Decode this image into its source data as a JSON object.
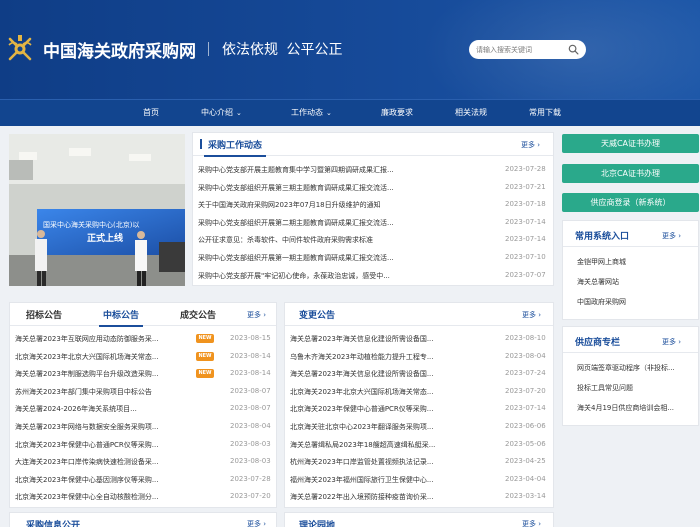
{
  "header": {
    "title": "中国海关政府采购网",
    "slogan": "依法依规  公平公正",
    "search_placeholder": "请输入搜索关键词"
  },
  "nav": [
    {
      "label": "首页",
      "has_menu": false
    },
    {
      "label": "中心介绍",
      "has_menu": true
    },
    {
      "label": "工作动态",
      "has_menu": true
    },
    {
      "label": "廉政要求",
      "has_menu": false
    },
    {
      "label": "相关法规",
      "has_menu": false
    },
    {
      "label": "常用下载",
      "has_menu": false
    }
  ],
  "more_label": "更多",
  "photo": {
    "banner_line1": "国采中心海关采购中心(北京)以",
    "banner_line2": "正式上线"
  },
  "work_news": {
    "title": "采购工作动态",
    "items": [
      {
        "title": "采购中心党支部开展主题教育集中学习暨第四期调研成果汇报...",
        "date": "2023-07-28"
      },
      {
        "title": "采购中心党支部组织开展第三期主题教育调研成果汇报交流活...",
        "date": "2023-07-21"
      },
      {
        "title": "关于中国海关政府采购网2023年07月18日升级维护的通知",
        "date": "2023-07-18"
      },
      {
        "title": "采购中心党支部组织开展第二期主题教育调研成果汇报交流活...",
        "date": "2023-07-14"
      },
      {
        "title": "公开征求意见：杀毒软件、中间件软件政府采购需求标准",
        "date": "2023-07-14"
      },
      {
        "title": "采购中心党支部组织开展第一期主题教育调研成果汇报交流活...",
        "date": "2023-07-10"
      },
      {
        "title": "采购中心党支部开展\"牢记初心使命，永葆政治忠诚，感受中...",
        "date": "2023-07-07"
      }
    ]
  },
  "side_buttons": [
    "天威CA证书办理",
    "北京CA证书办理",
    "供应商登录（新系统）"
  ],
  "common_systems": {
    "title": "常用系统入口",
    "items": [
      "金铠甲网上商城",
      "海关总署网站",
      "中国政府采购网"
    ]
  },
  "supplier": {
    "title": "供应商专栏",
    "items": [
      "网页端签章驱动程序（非投标...",
      "投标工具常见问题",
      "海关4月19日供应商培训会相..."
    ]
  },
  "bids": {
    "tabs": [
      "招标公告",
      "中标公告",
      "成交公告"
    ],
    "new_label": "NEW",
    "items": [
      {
        "title": "海关总署2023年互联网应用动态防御服务采...",
        "date": "2023-08-15",
        "is_new": true
      },
      {
        "title": "北京海关2023年北京大兴国际机场海关常态...",
        "date": "2023-08-14",
        "is_new": true
      },
      {
        "title": "海关总署2023年制服选购平台升级改造采购...",
        "date": "2023-08-14",
        "is_new": true
      },
      {
        "title": "苏州海关2023年部门集中采购项目中标公告",
        "date": "2023-08-07",
        "is_new": false
      },
      {
        "title": "海关总署2024-2026年海关系统项目...",
        "date": "2023-08-07",
        "is_new": false
      },
      {
        "title": "海关总署2023年网络与数据安全服务采购项...",
        "date": "2023-08-04",
        "is_new": false
      },
      {
        "title": "北京海关2023年保健中心普通PCR仪等采购...",
        "date": "2023-08-03",
        "is_new": false
      },
      {
        "title": "大连海关2023年口岸传染病快速检测设备采...",
        "date": "2023-08-03",
        "is_new": false
      },
      {
        "title": "北京海关2023年保健中心基因测序仪等采购...",
        "date": "2023-07-28",
        "is_new": false
      },
      {
        "title": "北京海关2023年保健中心全自动核酸检测分...",
        "date": "2023-07-20",
        "is_new": false
      }
    ]
  },
  "changes": {
    "title": "变更公告",
    "items": [
      {
        "title": "海关总署2023年海关信息化建设所需设备国...",
        "date": "2023-08-10"
      },
      {
        "title": "乌鲁木齐海关2023年动植检能力提升工程专...",
        "date": "2023-08-04"
      },
      {
        "title": "海关总署2023年海关信息化建设所需设备国...",
        "date": "2023-07-24"
      },
      {
        "title": "北京海关2023年北京大兴国际机场海关常态...",
        "date": "2023-07-20"
      },
      {
        "title": "北京海关2023年保健中心普通PCR仪等采购...",
        "date": "2023-07-14"
      },
      {
        "title": "北京海关驻北京中心2023年翻译服务采购项...",
        "date": "2023-06-06"
      },
      {
        "title": "海关总署缉私局2023年18艘超高速缉私艇采...",
        "date": "2023-05-06"
      },
      {
        "title": "杭州海关2023年口岸监管处置视频执法记录...",
        "date": "2023-04-25"
      },
      {
        "title": "福州海关2023年福州国际旅行卫生保健中心...",
        "date": "2023-04-04"
      },
      {
        "title": "海关总署2022年出入境预防接种疫苗询价采...",
        "date": "2023-03-14"
      }
    ]
  },
  "bottom": {
    "left_title": "采购信息公开",
    "right_title": "理论园地"
  },
  "colors": {
    "header_blue": "#12458f",
    "accent_blue": "#1b4e9b",
    "button_green": "#2aa98b",
    "new_orange": "#f0931e"
  }
}
